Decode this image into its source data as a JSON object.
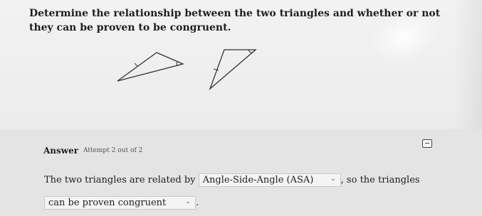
{
  "question": {
    "text": "Determine the relationship between the two triangles and whether or not they can be proven to be congruent."
  },
  "answer": {
    "label": "Answer",
    "attempt": "Attempt 2 out of 2",
    "sentence_start": "The two triangles are related by",
    "relationship_select": "Angle-Side-Angle (ASA)",
    "sentence_mid": ", so the triangles",
    "congruence_select": "can be proven congruent",
    "sentence_end": "."
  },
  "icons": {
    "calculator": "calculator-icon",
    "chevron": "chevron-down-icon"
  }
}
